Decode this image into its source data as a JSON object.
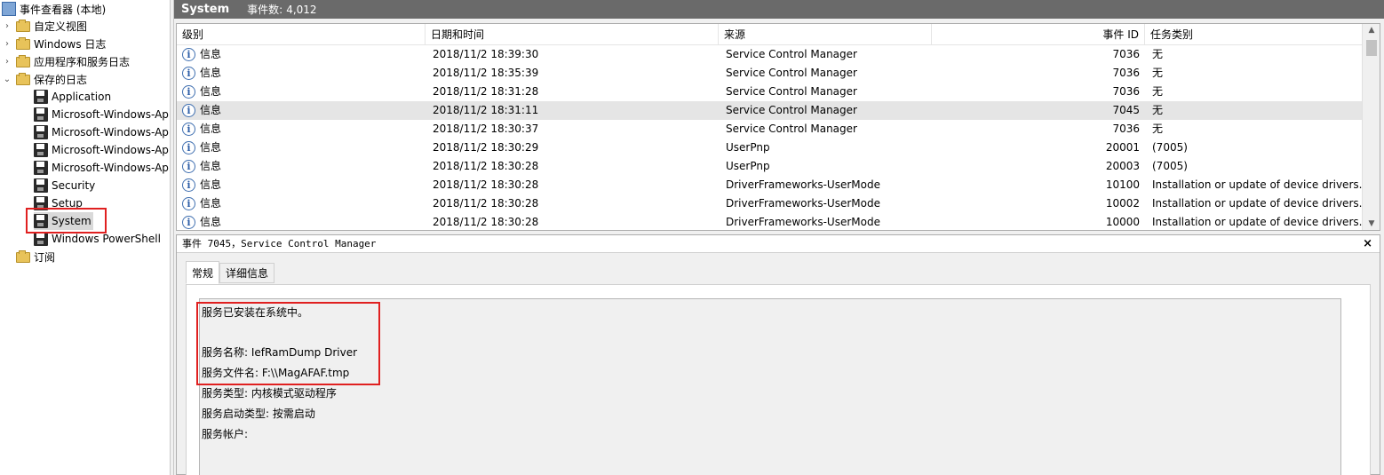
{
  "tree": {
    "root_label": "事件查看器 (本地)",
    "items": [
      {
        "label": "自定义视图",
        "kind": "folder",
        "expander": "›"
      },
      {
        "label": "Windows 日志",
        "kind": "folder",
        "expander": "›"
      },
      {
        "label": "应用程序和服务日志",
        "kind": "folder",
        "expander": "›"
      },
      {
        "label": "保存的日志",
        "kind": "folder",
        "expander": "⌄"
      }
    ],
    "saved_logs": [
      "Application",
      "Microsoft-Windows-Ap",
      "Microsoft-Windows-Ap",
      "Microsoft-Windows-Ap",
      "Microsoft-Windows-Ap",
      "Security",
      "Setup",
      "System",
      "Windows PowerShell"
    ],
    "subscriptions_label": "订阅",
    "selected": "System"
  },
  "header": {
    "log_name": "System",
    "event_count_label": "事件数:",
    "event_count": "4,012"
  },
  "grid": {
    "columns": [
      "级别",
      "日期和时间",
      "来源",
      "事件 ID",
      "任务类别"
    ],
    "rows": [
      {
        "level": "信息",
        "datetime": "2018/11/2 18:39:30",
        "source": "Service Control Manager",
        "event_id": "7036",
        "category": "无"
      },
      {
        "level": "信息",
        "datetime": "2018/11/2 18:35:39",
        "source": "Service Control Manager",
        "event_id": "7036",
        "category": "无"
      },
      {
        "level": "信息",
        "datetime": "2018/11/2 18:31:28",
        "source": "Service Control Manager",
        "event_id": "7036",
        "category": "无"
      },
      {
        "level": "信息",
        "datetime": "2018/11/2 18:31:11",
        "source": "Service Control Manager",
        "event_id": "7045",
        "category": "无"
      },
      {
        "level": "信息",
        "datetime": "2018/11/2 18:30:37",
        "source": "Service Control Manager",
        "event_id": "7036",
        "category": "无"
      },
      {
        "level": "信息",
        "datetime": "2018/11/2 18:30:29",
        "source": "UserPnp",
        "event_id": "20001",
        "category": "(7005)"
      },
      {
        "level": "信息",
        "datetime": "2018/11/2 18:30:28",
        "source": "UserPnp",
        "event_id": "20003",
        "category": "(7005)"
      },
      {
        "level": "信息",
        "datetime": "2018/11/2 18:30:28",
        "source": "DriverFrameworks-UserMode",
        "event_id": "10100",
        "category": "Installation or update of device drivers."
      },
      {
        "level": "信息",
        "datetime": "2018/11/2 18:30:28",
        "source": "DriverFrameworks-UserMode",
        "event_id": "10002",
        "category": "Installation or update of device drivers."
      },
      {
        "level": "信息",
        "datetime": "2018/11/2 18:30:28",
        "source": "DriverFrameworks-UserMode",
        "event_id": "10000",
        "category": "Installation or update of device drivers."
      }
    ],
    "selected_row": 3
  },
  "detail": {
    "title": "事件 7045，Service Control Manager",
    "close_glyph": "×",
    "tabs": [
      "常规",
      "详细信息"
    ],
    "active_tab": 0,
    "lines": [
      "服务已安装在系统中。",
      "",
      "服务名称: IefRamDump Driver",
      "服务文件名: F:\\\\MagAFAF.tmp",
      "服务类型: 内核模式驱动程序",
      "服务启动类型: 按需启动",
      "服务帐户:"
    ]
  },
  "colors": {
    "highlight_box": "#e02020",
    "titlebar": "#6a6a6a",
    "selected_row": "#e5e5e5"
  }
}
